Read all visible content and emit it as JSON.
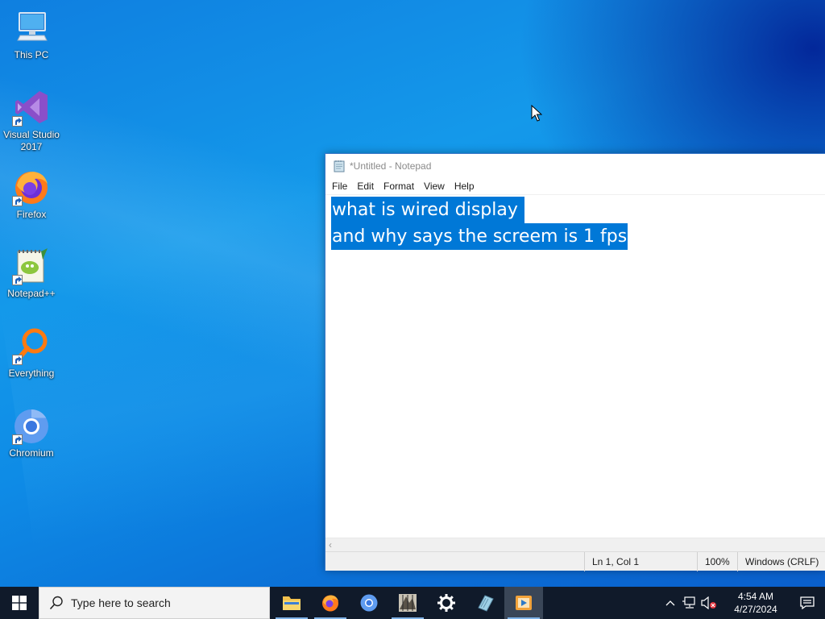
{
  "desktop": {
    "icons": [
      {
        "label": "This PC",
        "icon": "this-pc-icon"
      },
      {
        "label": "Visual Studio 2017",
        "icon": "visual-studio-icon"
      },
      {
        "label": "Firefox",
        "icon": "firefox-icon"
      },
      {
        "label": "Notepad++",
        "icon": "notepadpp-icon"
      },
      {
        "label": "Everything",
        "icon": "everything-icon"
      },
      {
        "label": "Chromium",
        "icon": "chromium-icon"
      }
    ]
  },
  "notepad": {
    "title": "*Untitled - Notepad",
    "menu": [
      "File",
      "Edit",
      "Format",
      "View",
      "Help"
    ],
    "lines": [
      "what is wired display ",
      "and why says the screem is 1 fps"
    ],
    "status": {
      "position": "Ln 1, Col 1",
      "zoom": "100%",
      "encoding": "Windows (CRLF)"
    },
    "selection_color": "#0078d7"
  },
  "taskbar": {
    "search_placeholder": "Type here to search",
    "apps": [
      "file-explorer-icon",
      "firefox-icon",
      "chromium-icon",
      "app-icon",
      "settings-icon",
      "notepad-icon",
      "media-icon"
    ],
    "clock": {
      "time": "4:54 AM",
      "date": "4/27/2024"
    }
  }
}
